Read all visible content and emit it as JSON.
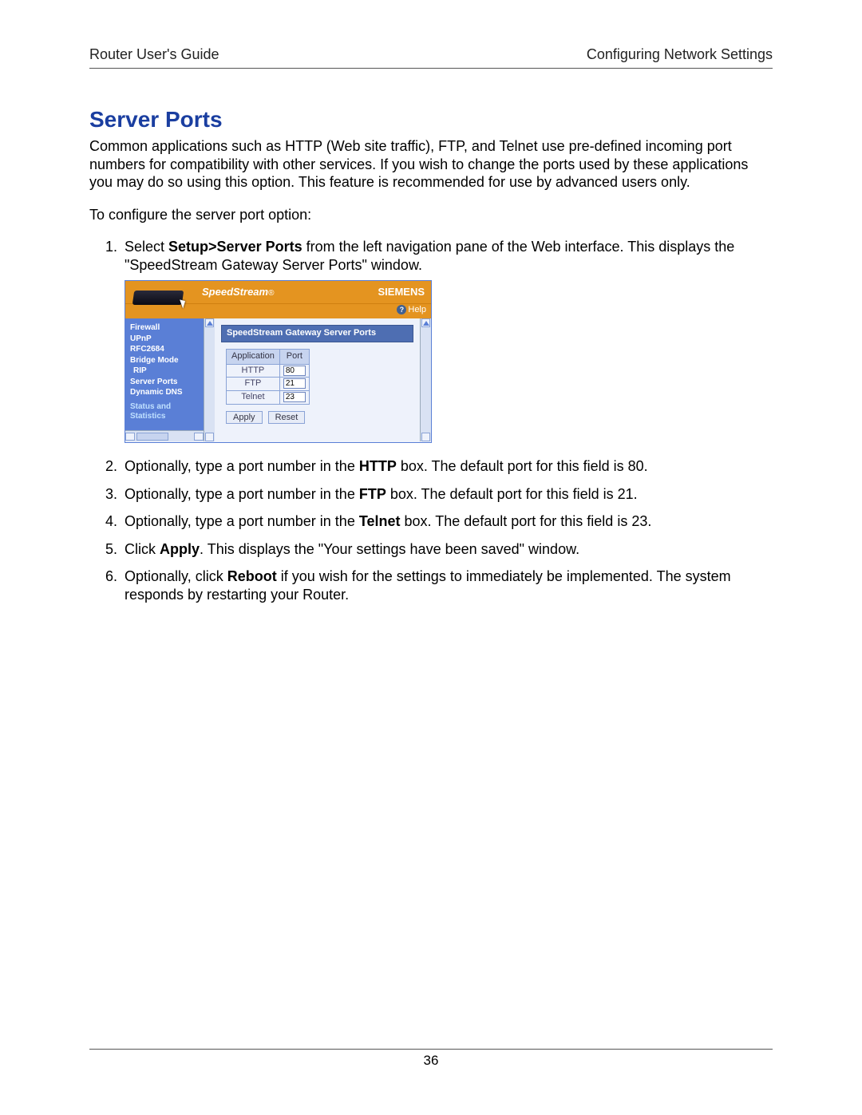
{
  "header": {
    "left": "Router User's Guide",
    "right": "Configuring Network Settings"
  },
  "title": "Server Ports",
  "intro": "Common applications such as HTTP (Web site traffic), FTP, and Telnet use pre-defined incoming port numbers for compatibility with other services. If you wish to change the ports used by these applications you may do so using this option. This feature is recommended for use by advanced users only.",
  "intro2": "To configure the server port option:",
  "steps": {
    "s1_a": "Select ",
    "s1_b": "Setup>Server Ports",
    "s1_c": " from the left navigation pane of the Web interface. This displays the \"SpeedStream Gateway Server Ports\" window.",
    "s2_a": "Optionally, type a port number in the ",
    "s2_b": "HTTP",
    "s2_c": " box. The default port for this field is 80.",
    "s3_a": "Optionally, type a port number in the ",
    "s3_b": "FTP",
    "s3_c": " box. The default port for this field is 21.",
    "s4_a": "Optionally, type a port number in the ",
    "s4_b": "Telnet",
    "s4_c": " box. The default port for this field is 23.",
    "s5_a": "Click ",
    "s5_b": "Apply",
    "s5_c": ". This displays the \"Your settings have been saved\" window.",
    "s6_a": "Optionally, click ",
    "s6_b": "Reboot",
    "s6_c": " if you wish for the settings to immediately be implemented. The system responds by restarting your Router."
  },
  "shot": {
    "brand": "SpeedStream",
    "vendor": "SIEMENS",
    "help": "Help",
    "sidebar": {
      "items": [
        "Firewall",
        "UPnP",
        "RFC2684",
        "Bridge Mode",
        "RIP",
        "Server Ports",
        "Dynamic DNS"
      ],
      "section": "Status and Statistics"
    },
    "panel_title": "SpeedStream Gateway Server Ports",
    "table": {
      "head_app": "Application",
      "head_port": "Port",
      "rows": [
        {
          "app": "HTTP",
          "port": "80"
        },
        {
          "app": "FTP",
          "port": "21"
        },
        {
          "app": "Telnet",
          "port": "23"
        }
      ]
    },
    "buttons": {
      "apply": "Apply",
      "reset": "Reset"
    }
  },
  "page_number": "36"
}
